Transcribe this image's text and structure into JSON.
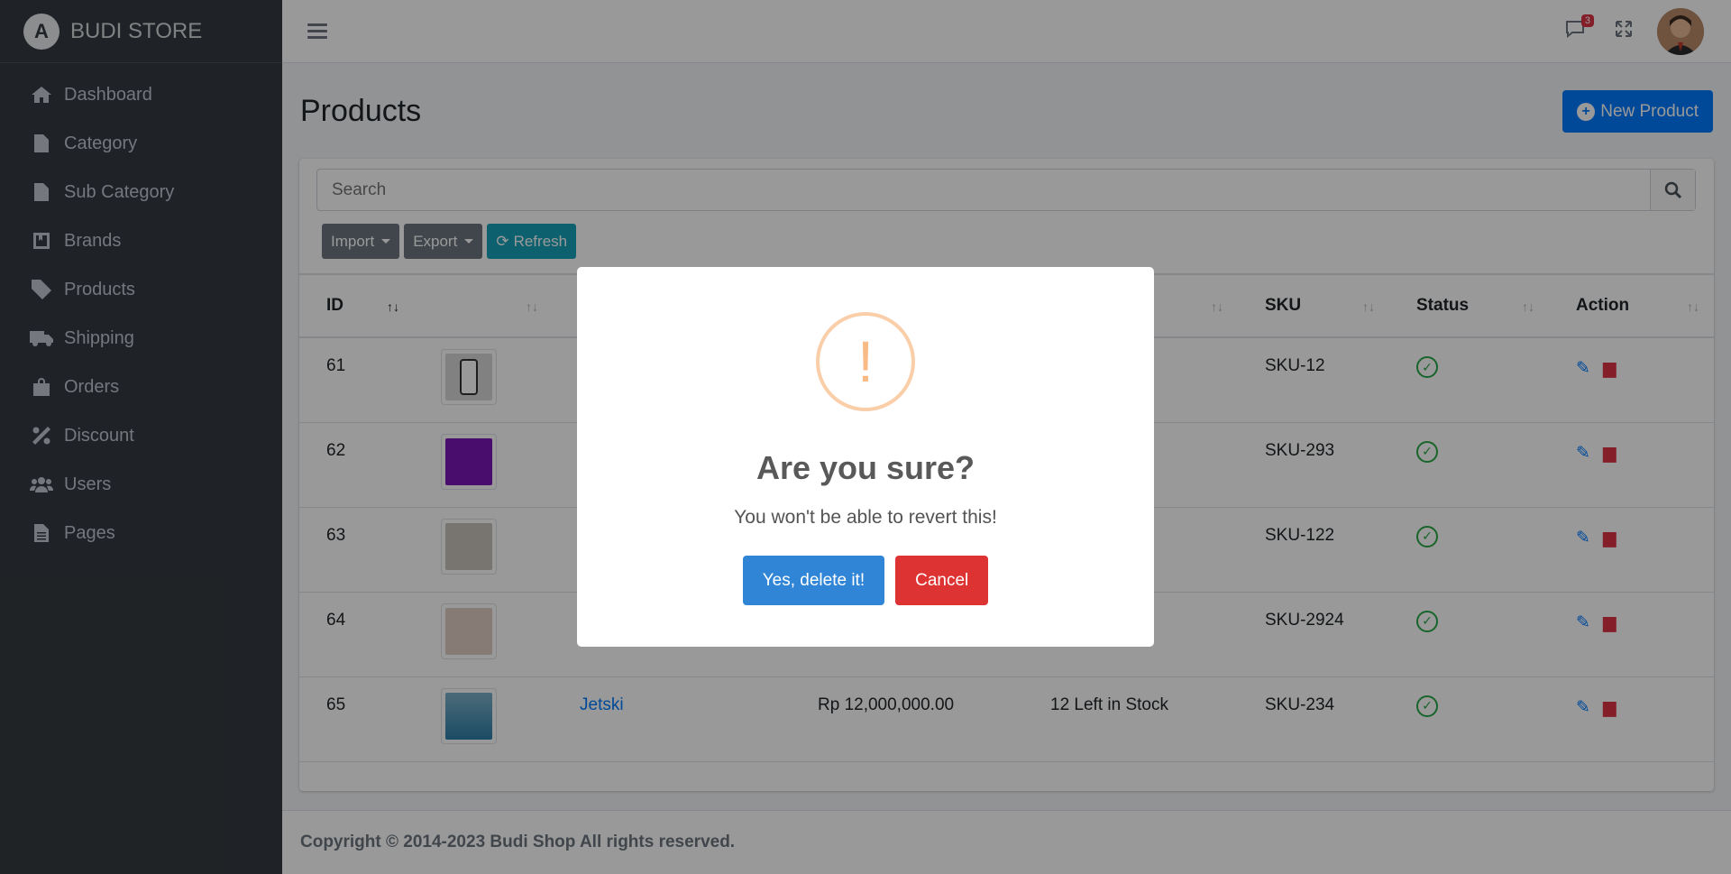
{
  "brand": {
    "name": "BUDI STORE",
    "logo_letter": "A"
  },
  "sidebar": {
    "items": [
      {
        "label": "Dashboard",
        "icon": "home-icon"
      },
      {
        "label": "Category",
        "icon": "file-icon"
      },
      {
        "label": "Sub Category",
        "icon": "file-icon"
      },
      {
        "label": "Brands",
        "icon": "book-icon"
      },
      {
        "label": "Products",
        "icon": "tag-icon"
      },
      {
        "label": "Shipping",
        "icon": "truck-icon"
      },
      {
        "label": "Orders",
        "icon": "shopping-bag-icon"
      },
      {
        "label": "Discount",
        "icon": "percent-icon"
      },
      {
        "label": "Users",
        "icon": "users-icon"
      },
      {
        "label": "Pages",
        "icon": "file-alt-icon"
      }
    ]
  },
  "header": {
    "notification_count": "3"
  },
  "page": {
    "title": "Products",
    "new_button": "New Product"
  },
  "search": {
    "placeholder": "Search"
  },
  "toolbar": {
    "import_label": "Import",
    "export_label": "Export",
    "refresh_label": "Refresh"
  },
  "table": {
    "headers": [
      "ID",
      "",
      "",
      "",
      "",
      "SKU",
      "Status",
      "Action"
    ],
    "rows": [
      {
        "id": "61",
        "name": "",
        "price": "",
        "stock": "k",
        "sku": "SKU-12"
      },
      {
        "id": "62",
        "name": "",
        "price": "",
        "stock": "k",
        "sku": "SKU-293"
      },
      {
        "id": "63",
        "name": "",
        "price": "",
        "stock": "",
        "sku": "SKU-122"
      },
      {
        "id": "64",
        "name": "",
        "price": "",
        "stock": "k",
        "sku": "SKU-2924"
      },
      {
        "id": "65",
        "name": "Jetski",
        "price": "Rp 12,000,000.00",
        "stock": "12 Left in Stock",
        "sku": "SKU-234"
      }
    ]
  },
  "footer": {
    "text": "Copyright © 2014-2023 Budi Shop All rights reserved."
  },
  "modal": {
    "icon": "!",
    "title": "Are you sure?",
    "text": "You won't be able to revert this!",
    "confirm_label": "Yes, delete it!",
    "cancel_label": "Cancel"
  }
}
